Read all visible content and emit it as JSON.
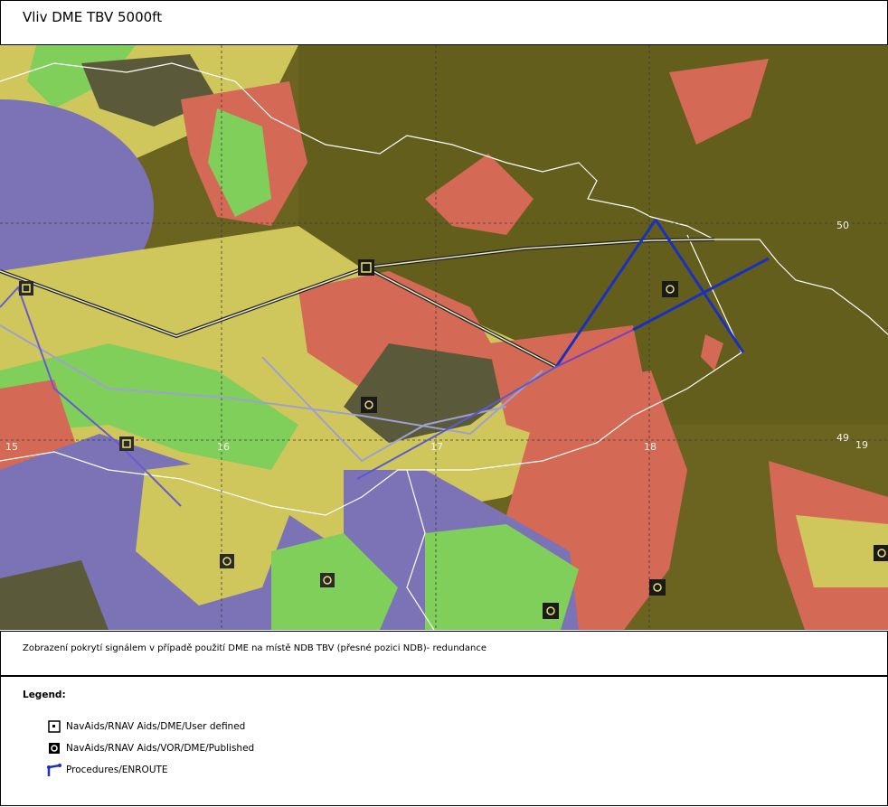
{
  "title": "Vliv DME TBV 5000ft",
  "description": "Zobrazení pokrytí signálem v případě použití DME na místě NDB TBV (přesné pozici NDB)- redundance",
  "map": {
    "grid_labels": {
      "lat_50": "50",
      "lat_49": "49",
      "lon_15": "15",
      "lon_16": "16",
      "lon_17": "17",
      "lon_18": "18",
      "lon_19": "19"
    },
    "colors": {
      "background": "#6b6420",
      "blue": "#7b73b5",
      "yellow": "#cfc75b",
      "green": "#7fcf5a",
      "red": "#d46a55",
      "dark": "#5a5a3a",
      "route_blue": "#1b2fc0",
      "route_light": "#9ea0d0",
      "border": "#ffffff"
    }
  },
  "legend": {
    "title": "Legend:",
    "items": [
      {
        "label": "NavAids/RNAV Aids/DME/User defined",
        "icon": "dme-user-defined-icon"
      },
      {
        "label": "NavAids/RNAV Aids/VOR/DME/Published",
        "icon": "vor-dme-published-icon"
      },
      {
        "label": "Procedures/ENROUTE",
        "icon": "enroute-procedure-icon"
      }
    ]
  }
}
